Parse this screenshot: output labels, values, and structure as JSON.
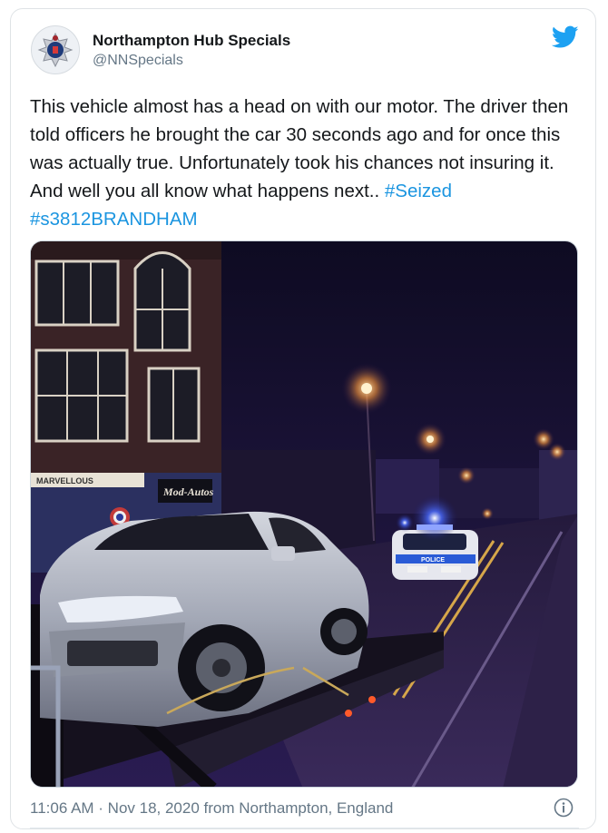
{
  "tweet": {
    "display_name": "Northampton Hub Specials",
    "handle": "@NNSpecials",
    "body_text": "This vehicle almost has a head on with our motor. The driver then told officers he brought the car 30 seconds ago and for once this was actually true. Unfortunately took his chances not insuring it. And well you all know what happens next..",
    "hashtags": [
      "#Seized",
      "#s3812BRANDHAM"
    ],
    "timestamp": "11:06 AM · Nov 18, 2020 from Northampton, England"
  },
  "photo": {
    "storefront_signs": [
      "MARVELLOUS",
      "Mod-Autos"
    ],
    "police_car_label": "POLICE"
  },
  "icons": {
    "avatar": "police-crest-icon",
    "brand": "twitter-bird-icon",
    "info": "info-icon"
  },
  "colors": {
    "link": "#1b95e0",
    "twitter_blue": "#1da1f2",
    "text": "#14171a",
    "secondary_text": "#657786"
  }
}
